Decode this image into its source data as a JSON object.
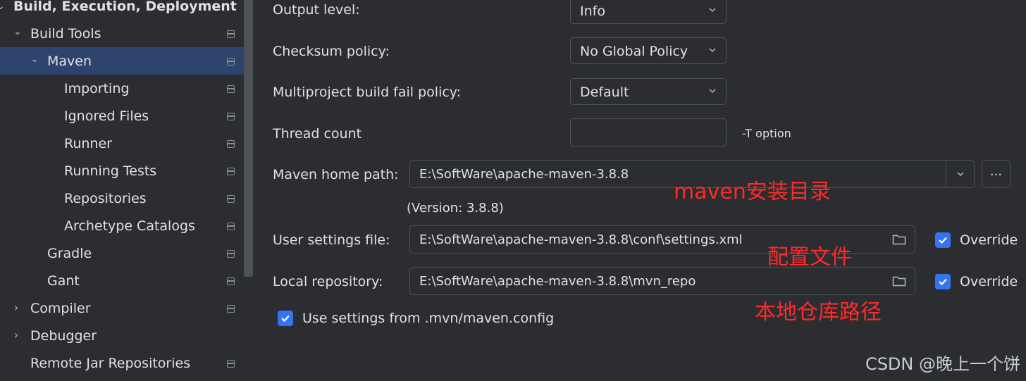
{
  "sidebar": {
    "items": [
      {
        "label": "Build, Execution, Deployment",
        "expanded": true
      },
      {
        "label": "Build Tools",
        "expanded": true
      },
      {
        "label": "Maven",
        "expanded": true,
        "selected": true
      },
      {
        "label": "Importing"
      },
      {
        "label": "Ignored Files"
      },
      {
        "label": "Runner"
      },
      {
        "label": "Running Tests"
      },
      {
        "label": "Repositories"
      },
      {
        "label": "Archetype Catalogs"
      },
      {
        "label": "Gradle"
      },
      {
        "label": "Gant"
      },
      {
        "label": "Compiler",
        "expanded": false
      },
      {
        "label": "Debugger",
        "expanded": false
      },
      {
        "label": "Remote Jar Repositories"
      }
    ]
  },
  "settings": {
    "output_level_label": "Output level:",
    "output_level_value": "Info",
    "checksum_label": "Checksum policy:",
    "checksum_value": "No Global Policy",
    "multiproject_label": "Multiproject build fail policy:",
    "multiproject_value": "Default",
    "thread_count_label": "Thread count",
    "thread_count_value": "",
    "thread_hint": "-T option",
    "maven_home_label": "Maven home path:",
    "maven_home_value": "E:\\SoftWare\\apache-maven-3.8.8",
    "browse_label": "...",
    "version_text": "(Version: 3.8.8)",
    "user_settings_label": "User settings file:",
    "user_settings_value": "E:\\SoftWare\\apache-maven-3.8.8\\conf\\settings.xml",
    "local_repo_label": "Local repository:",
    "local_repo_value": "E:\\SoftWare\\apache-maven-3.8.8\\mvn_repo",
    "override_label": "Override",
    "use_settings_label": "Use settings from .mvn/maven.config"
  },
  "annotations": {
    "maven_home": "maven安装目录",
    "settings_file": "配置文件",
    "local_repo": "本地仓库路径"
  },
  "watermark": "CSDN @晚上一个饼",
  "colors": {
    "background": "#2b2d30",
    "selection": "#2e436e",
    "checkbox": "#3574f0",
    "annotation": "#ff2a2a"
  }
}
